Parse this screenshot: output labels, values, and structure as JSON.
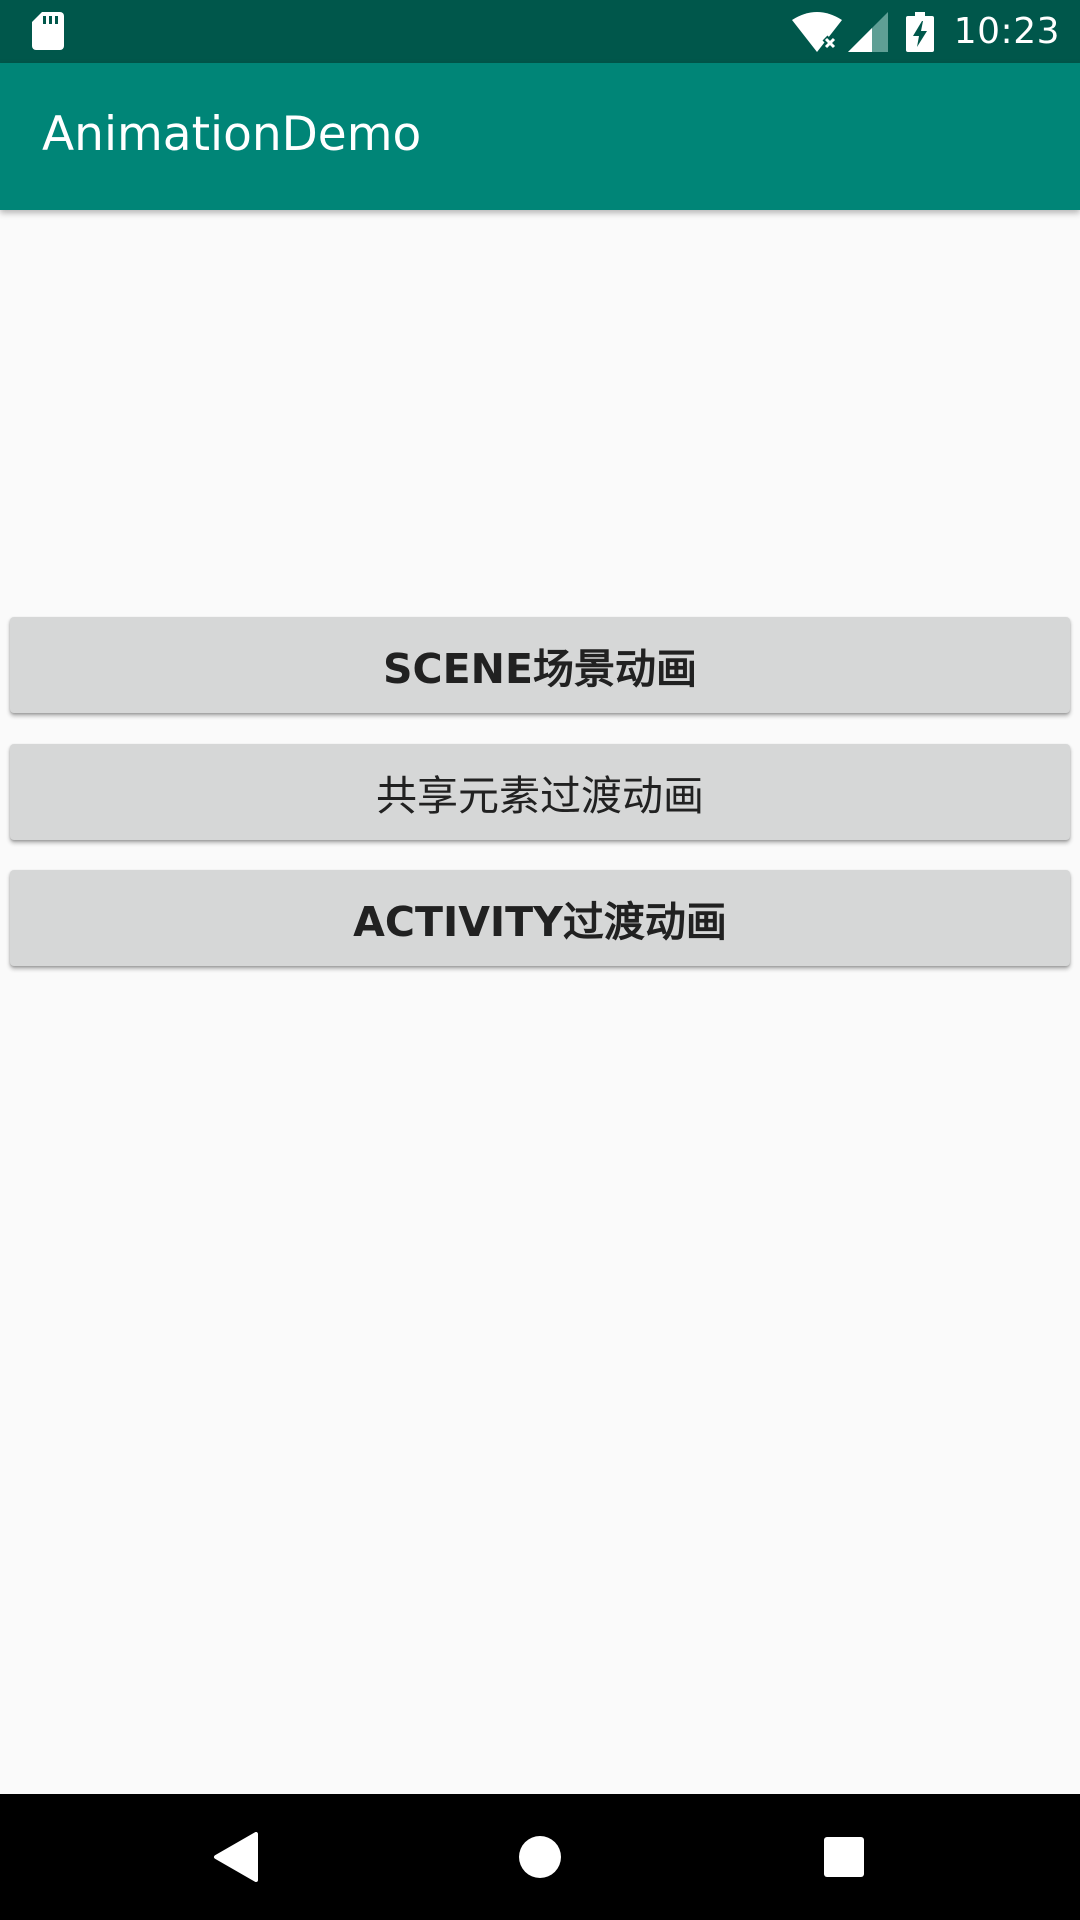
{
  "status_bar": {
    "time": "10:23",
    "icons": [
      "sd-card-icon",
      "wifi-icon",
      "signal-icon",
      "battery-charging-icon"
    ]
  },
  "app_bar": {
    "title": "AnimationDemo"
  },
  "buttons": [
    {
      "label": "SCENE场景动画"
    },
    {
      "label": "共享元素过渡动画"
    },
    {
      "label": "ACTIVITY过渡动画"
    }
  ],
  "nav_bar": {
    "icons": [
      "back-icon",
      "home-icon",
      "recents-icon"
    ]
  },
  "colors": {
    "status_bar": "#00574b",
    "app_bar": "#008577",
    "background": "#fafafa",
    "button": "#d6d7d7",
    "button_text": "#212121",
    "nav_bar": "#000000"
  }
}
